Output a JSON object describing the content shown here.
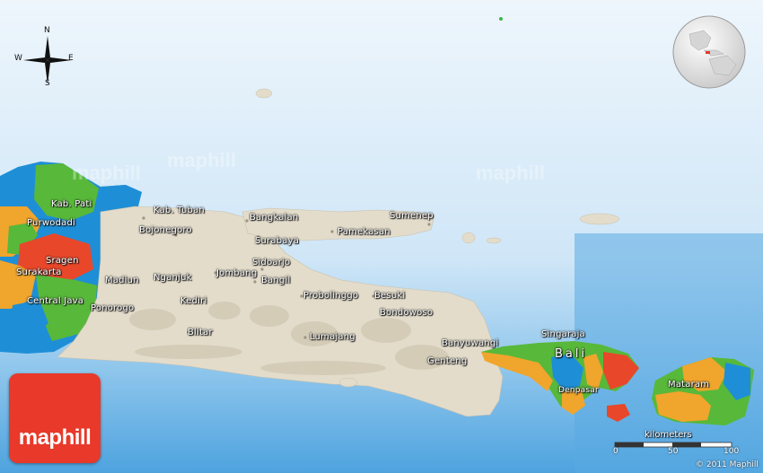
{
  "map": {
    "colors": {
      "sea_light": "#e9f3fb",
      "sea_mid": "#bcdcf2",
      "sea_deep": "#4da3df",
      "land_relief": "#e3dccb",
      "province_blue": "#1e8fd6",
      "province_green": "#58b83a",
      "province_orange": "#f0a52c",
      "province_red": "#e8472a",
      "brand_red": "#e8392a"
    },
    "compass": {
      "north": "N",
      "south": "S",
      "east": "E",
      "west": "W"
    },
    "places": [
      {
        "id": "kab-pati",
        "name": "Kab. Pati"
      },
      {
        "id": "purwodadi",
        "name": "Purwodadi"
      },
      {
        "id": "kab-tuban",
        "name": "Kab. Tuban"
      },
      {
        "id": "bojonegoro",
        "name": "Bojonegoro"
      },
      {
        "id": "bangkalan",
        "name": "Bangkalan"
      },
      {
        "id": "sumenep",
        "name": "Sumenep"
      },
      {
        "id": "surabaya",
        "name": "Surabaya"
      },
      {
        "id": "pamekasan",
        "name": "Pamekasan"
      },
      {
        "id": "sragen",
        "name": "Sragen"
      },
      {
        "id": "surakarta",
        "name": "Surakarta"
      },
      {
        "id": "jombang",
        "name": "Jombang"
      },
      {
        "id": "sidoarjo",
        "name": "Sidoarjo"
      },
      {
        "id": "madiun",
        "name": "Madiun"
      },
      {
        "id": "nganjuk",
        "name": "Nganjuk"
      },
      {
        "id": "bangil",
        "name": "Bangil"
      },
      {
        "id": "central-java",
        "name": "Central Java"
      },
      {
        "id": "kediri",
        "name": "Kediri"
      },
      {
        "id": "probolinggo",
        "name": "Probolinggo"
      },
      {
        "id": "besuki",
        "name": "Besuki"
      },
      {
        "id": "ponorogo",
        "name": "Ponorogo"
      },
      {
        "id": "bondowoso",
        "name": "Bondowoso"
      },
      {
        "id": "blitar",
        "name": "Blitar"
      },
      {
        "id": "lumajang",
        "name": "Lumajang"
      },
      {
        "id": "banyuwangi",
        "name": "Banyuwangi"
      },
      {
        "id": "singaraja",
        "name": "Singaraja"
      },
      {
        "id": "genteng",
        "name": "Genteng"
      },
      {
        "id": "bali",
        "name": "Bali"
      },
      {
        "id": "mataram",
        "name": "Mataram"
      },
      {
        "id": "denpasar",
        "name": "Denpasar"
      }
    ],
    "scale": {
      "title": "kilometers",
      "ticks": [
        "0",
        "50",
        "100"
      ]
    },
    "watermark": "maphill",
    "brand": "maphill",
    "copyright": "© 2011 Maphill"
  }
}
